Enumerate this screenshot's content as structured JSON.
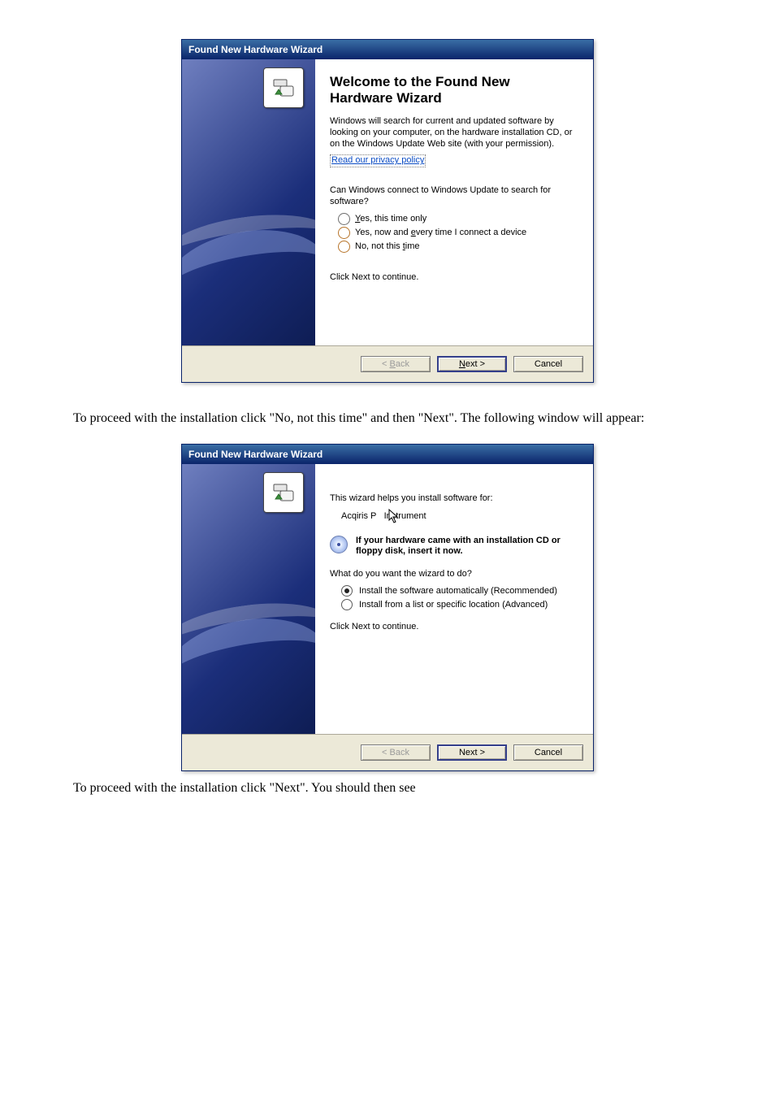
{
  "dialog1": {
    "title": "Found New Hardware Wizard",
    "heading_line1": "Welcome to the Found New",
    "heading_line2": "Hardware Wizard",
    "intro": "Windows will search for current and updated software by looking on your computer, on the hardware installation CD, or on the Windows Update Web site (with your permission).",
    "privacy_link": "Read our privacy policy",
    "question": "Can Windows connect to Windows Update to search for software?",
    "options": {
      "opt1": "Yes, this time only",
      "opt2": "Yes, now and every time I connect a device",
      "opt3": "No, not this time"
    },
    "click_next": "Click Next to continue.",
    "buttons": {
      "back": "< Back",
      "next": "Next >",
      "cancel": "Cancel"
    }
  },
  "doc_text1": "To proceed with the installation click \"No, not this time\" and then \"Next\". The following window will appear:",
  "dialog2": {
    "title": "Found New Hardware Wizard",
    "helps_text": "This wizard helps you install software for:",
    "device_name": "Acqiris PCI Instrument",
    "cd_text": "If your hardware came with an installation CD or floppy disk, insert it now.",
    "what_do": "What do you want the wizard to do?",
    "options": {
      "auto": "Install the software automatically (Recommended)",
      "list": "Install from a list or specific location (Advanced)"
    },
    "click_next": "Click Next to continue.",
    "buttons": {
      "back": "< Back",
      "next": "Next >",
      "cancel": "Cancel"
    }
  },
  "doc_text2": "To proceed with the installation click \"Next\".  You should then see"
}
